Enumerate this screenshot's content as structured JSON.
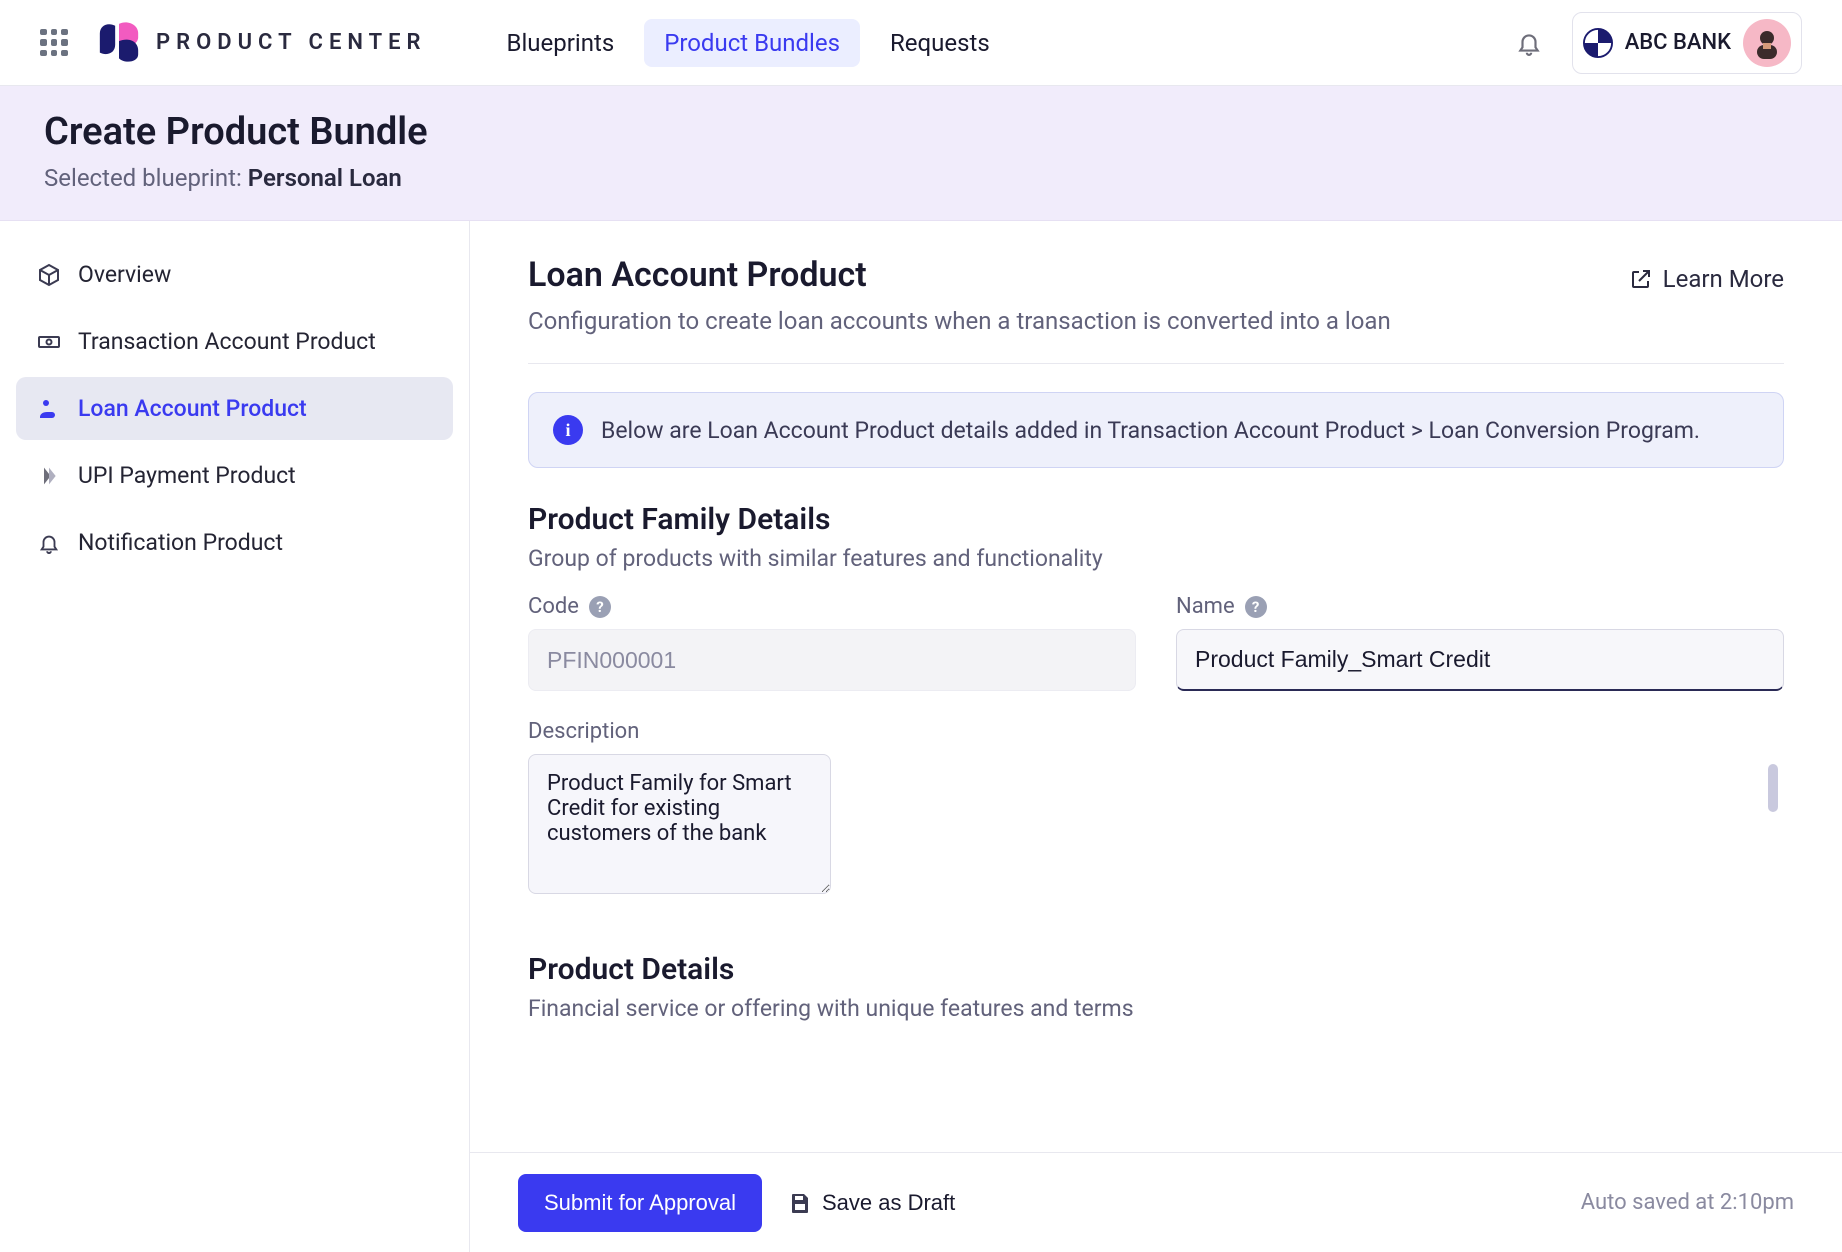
{
  "brand": "PRODUCT CENTER",
  "nav": {
    "tabs": [
      {
        "label": "Blueprints",
        "active": false
      },
      {
        "label": "Product Bundles",
        "active": true
      },
      {
        "label": "Requests",
        "active": false
      }
    ],
    "tenant": "ABC BANK"
  },
  "header": {
    "title": "Create Product Bundle",
    "sub_prefix": "Selected blueprint: ",
    "sub_bold": "Personal Loan"
  },
  "sidebar": {
    "items": [
      {
        "label": "Overview"
      },
      {
        "label": "Transaction Account Product"
      },
      {
        "label": "Loan Account Product"
      },
      {
        "label": "UPI Payment Product"
      },
      {
        "label": "Notification Product"
      }
    ],
    "activeIndex": 2
  },
  "main": {
    "title": "Loan Account Product",
    "subtitle": "Configuration to create loan accounts when a transaction is converted into a loan",
    "learn_more": "Learn More",
    "banner": "Below are Loan Account Product details added in Transaction Account Product > Loan Conversion Program.",
    "family": {
      "title": "Product Family Details",
      "desc": "Group of products with similar features and functionality",
      "code_label": "Code",
      "code_value": "PFIN000001",
      "name_label": "Name",
      "name_value": "Product Family_Smart Credit",
      "description_label": "Description",
      "description_value": "Product Family for Smart Credit for existing customers of the bank"
    },
    "details": {
      "title": "Product Details",
      "desc": "Financial service or offering with unique features and terms"
    }
  },
  "footer": {
    "submit": "Submit for Approval",
    "draft": "Save as Draft",
    "autosave": "Auto saved at 2:10pm"
  }
}
